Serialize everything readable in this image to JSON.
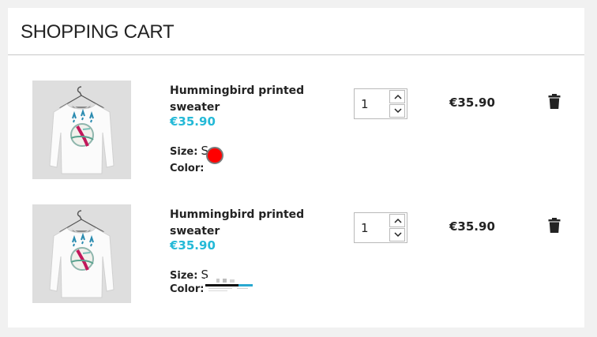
{
  "header": {
    "title": "SHOPPING CART"
  },
  "items": [
    {
      "name": "Hummingbird printed sweater",
      "price": "€35.90",
      "size_label": "Size:",
      "size_value": "S",
      "color_label": "Color:",
      "color_swatch": "#ff0000",
      "quantity": "1",
      "total": "€35.90",
      "delete_icon": "trash-icon"
    },
    {
      "name": "Hummingbird printed sweater",
      "price": "€35.90",
      "size_label": "Size:",
      "size_value": "S",
      "color_label": "Color:",
      "color_swatch": "image-texture",
      "quantity": "1",
      "total": "€35.90",
      "delete_icon": "trash-icon"
    }
  ],
  "colors": {
    "accent_price": "#24b9d7",
    "text": "#232323",
    "background": "#f1f1f1"
  }
}
